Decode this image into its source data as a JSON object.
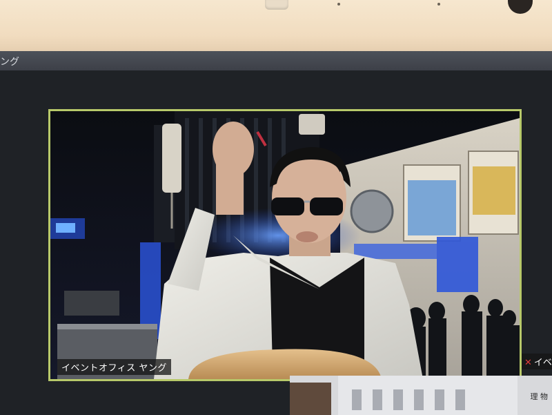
{
  "window": {
    "title": "ング"
  },
  "main_video": {
    "participant_name": "イベントオフィス ヤング",
    "description_colors": {
      "border": "#b8c96a",
      "lights": "#4a7bff"
    }
  },
  "side_participant": {
    "label": "イベ",
    "mic_icon": "mic-muted-icon"
  },
  "thumbnail": {
    "text": "理 物"
  }
}
